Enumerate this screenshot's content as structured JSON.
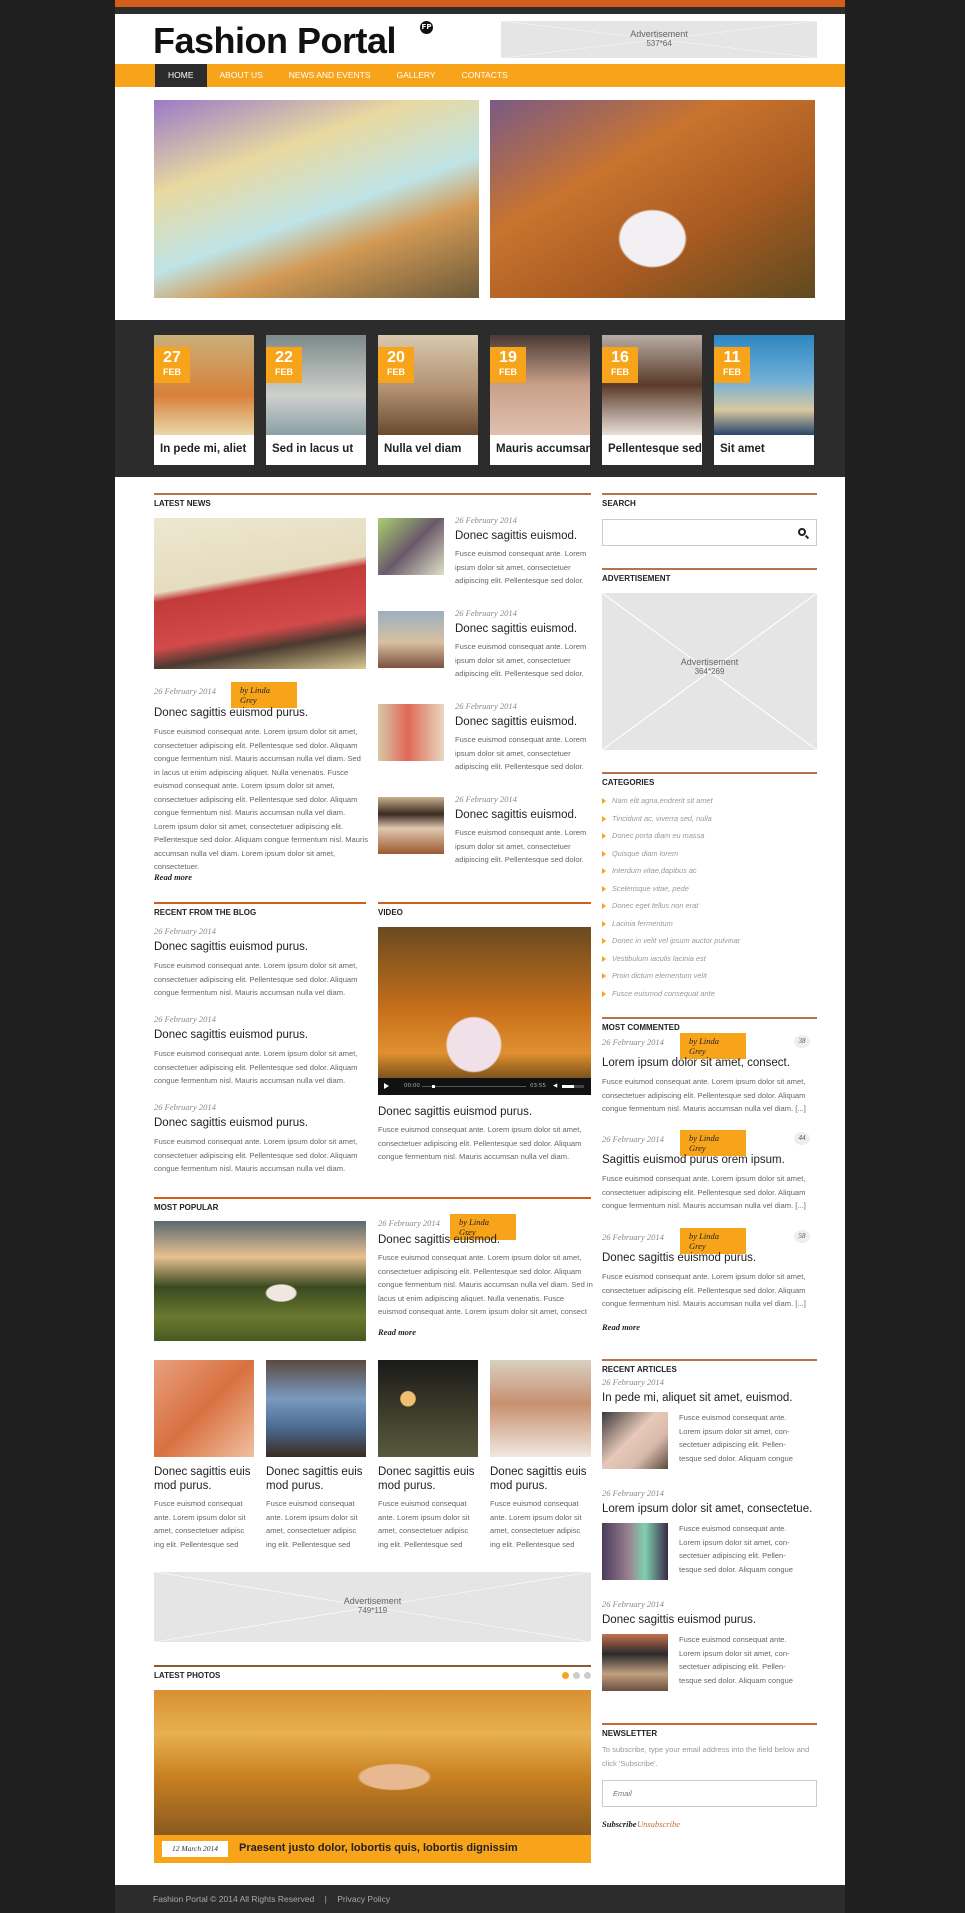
{
  "header": {
    "logo": "Fashion Portal",
    "logo_mark": "FP",
    "ad": {
      "label": "Advertisement",
      "size": "537*64"
    }
  },
  "nav": {
    "items": [
      {
        "label": "HOME",
        "active": true
      },
      {
        "label": "ABOUT US"
      },
      {
        "label": "NEWS AND EVENTS"
      },
      {
        "label": "GALLERY"
      },
      {
        "label": "CONTACTS"
      }
    ]
  },
  "hero": {
    "images": [
      "woman-with-painted-horse",
      "bride-in-autumn-field"
    ]
  },
  "featured_strip": [
    {
      "day": "27",
      "month": "FEB",
      "caption": "In pede mi, aliet"
    },
    {
      "day": "22",
      "month": "FEB",
      "caption": "Sed in lacus ut"
    },
    {
      "day": "20",
      "month": "FEB",
      "caption": "Nulla vel diam"
    },
    {
      "day": "19",
      "month": "FEB",
      "caption": "Mauris accumsan"
    },
    {
      "day": "16",
      "month": "FEB",
      "caption": "Pellentesque sed"
    },
    {
      "day": "11",
      "month": "FEB",
      "caption": "Sit amet"
    }
  ],
  "latest_news": {
    "title": "LATEST NEWS",
    "main": {
      "date": "26 February 2014",
      "author": "by Linda Grey",
      "headline": "Donec sagittis euismod purus.",
      "body": "Fusce euismod consequat ante. Lorem ipsum dolor sit amet, consectetuer adipiscing elit. Pellentesque sed dolor. Aliquam congue fermentum nisl. Mauris accumsan nulla vel diam. Sed in lacus ut enim adipiscing aliquet. Nulla venenatis. Fusce euismod consequat ante. Lorem ipsum dolor sit amet, consectetuer adipiscing elit. Pellentesque sed dolor. Aliquam congue fermentum nisl. Mauris accumsan nulla vel diam. Lorem ipsum dolor sit amet, consectetuer adipiscing elit. Pellentesque sed dolor. Aliquam congue fermentum nisl. Mauris accumsan nulla vel diam. Lorem ipsum dolor sit amet, consectetuer.",
      "read_more": "Read more"
    },
    "items": [
      {
        "date": "26 February 2014",
        "headline": "Donec sagittis euismod.",
        "body": "Fusce euismod consequat ante. Lorem ipsum dolor sit amet, consectetuer adipiscing elit. Pellentesque sed dolor."
      },
      {
        "date": "26 February 2014",
        "headline": "Donec sagittis euismod.",
        "body": "Fusce euismod consequat ante. Lorem ipsum dolor sit amet, consectetuer adipiscing elit. Pellentesque sed dolor."
      },
      {
        "date": "26 February 2014",
        "headline": "Donec sagittis euismod.",
        "body": "Fusce euismod consequat ante. Lorem ipsum dolor sit amet, consectetuer adipiscing elit. Pellentesque sed dolor."
      },
      {
        "date": "26 February 2014",
        "headline": "Donec sagittis euismod.",
        "body": "Fusce euismod consequat ante. Lorem ipsum dolor sit amet, consectetuer adipiscing elit. Pellentesque sed dolor."
      }
    ]
  },
  "recent_blog": {
    "title": "RECENT FROM THE BLOG",
    "items": [
      {
        "date": "26 February 2014",
        "headline": "Donec sagittis euismod purus.",
        "body": "Fusce euismod consequat ante. Lorem ipsum dolor sit amet, consectetuer adipiscing elit. Pellentesque sed dolor. Aliquam congue fermentum nisl. Mauris accumsan nulla vel diam."
      },
      {
        "date": "26 February 2014",
        "headline": "Donec sagittis euismod purus.",
        "body": "Fusce euismod consequat ante. Lorem ipsum dolor sit amet, consectetuer adipiscing elit. Pellentesque sed dolor. Aliquam congue fermentum nisl. Mauris accumsan nulla vel diam."
      },
      {
        "date": "26 February 2014",
        "headline": "Donec sagittis euismod purus.",
        "body": "Fusce euismod consequat ante. Lorem ipsum dolor sit amet, consectetuer adipiscing elit. Pellentesque sed dolor. Aliquam congue fermentum nisl. Mauris accumsan nulla vel diam."
      }
    ]
  },
  "video": {
    "title": "VIDEO",
    "current_time": "00:00",
    "duration": "03:55",
    "progress": 0.08,
    "headline": "Donec sagittis euismod purus.",
    "body": "Fusce euismod consequat ante. Lorem ipsum dolor sit amet, consectetuer adipiscing elit. Pellentesque sed dolor. Aliquam congue fermentum nisl. Mauris accumsan nulla vel diam."
  },
  "most_popular": {
    "title": "MOST POPULAR",
    "main": {
      "date": "26 February 2014",
      "author": "by Linda Grey",
      "headline": "Donec sagittis euismod.",
      "body": "Fusce euismod consequat ante. Lorem ipsum dolor sit amet, consectetuer adipiscing elit. Pellentesque sed dolor. Aliquam congue fermentum nisl. Mauris accumsan nulla vel diam. Sed in lacus ut enim adipiscing aliquet. Nulla venenatis. Fusce euismod consequat ante. Lorem ipsum dolor sit amet, consect",
      "read_more": "Read more"
    },
    "grid": [
      {
        "headline": "Donec sagittis euis mod purus.",
        "body": "Fusce euismod consequat ante. Lorem ipsum dolor sit amet, consectetuer adipisc ing elit. Pellentesque sed"
      },
      {
        "headline": "Donec sagittis euis mod purus.",
        "body": "Fusce euismod consequat ante. Lorem ipsum dolor sit amet, consectetuer adipisc ing elit. Pellentesque sed"
      },
      {
        "headline": "Donec sagittis euis mod purus.",
        "body": "Fusce euismod consequat ante. Lorem ipsum dolor sit amet, consectetuer adipisc ing elit. Pellentesque sed"
      },
      {
        "headline": "Donec sagittis euis mod purus.",
        "body": "Fusce euismod consequat ante. Lorem ipsum dolor sit amet, consectetuer adipisc ing elit. Pellentesque sed"
      }
    ]
  },
  "wide_ad": {
    "label": "Advertisement",
    "size": "749*119"
  },
  "latest_photos": {
    "title": "LATEST PHOTOS",
    "date": "12 March 2014",
    "caption": "Praesent justo dolor, lobortis quis, lobortis dignissim",
    "slides": 3,
    "active_slide": 1
  },
  "sidebar": {
    "search": {
      "title": "SEARCH",
      "placeholder": ""
    },
    "ad": {
      "title": "ADVERTISEMENT",
      "label": "Advertisement",
      "size": "364*269"
    },
    "categories": {
      "title": "CATEGORIES",
      "items": [
        "Nam elit agna,endrerit sit amet",
        "Tincidunt ac, viverra sed, nulla",
        "Donec porta diam eu massa",
        "Quisque diam lorem",
        "Interdum vitae,dapibus ac",
        "Scelerisque vitae, pede",
        "Donec eget tellus non erat",
        "Lacinia fermentum",
        "Donec in velit vel ipsum auctor pulvinar",
        "Vestibulum iaculis lacinia est",
        "Proin dictum elementum velit",
        "Fusce euismod consequat ante"
      ]
    },
    "most_commented": {
      "title": "MOST COMMENTED",
      "items": [
        {
          "date": "26 February 2014",
          "author": "by Linda Grey",
          "comments": "38",
          "headline": "Lorem ipsum dolor sit amet, consect.",
          "body": "Fusce euismod consequat ante. Lorem ipsum dolor sit amet, consectetuer adipiscing elit. Pellentesque sed dolor. Aliquam congue fermentum nisl. Mauris accumsan nulla vel diam. [...]"
        },
        {
          "date": "26 February 2014",
          "author": "by Linda Grey",
          "comments": "44",
          "headline": "Sagittis euismod purus orem ipsum.",
          "body": "Fusce euismod consequat ante. Lorem ipsum dolor sit amet, consectetuer adipiscing elit. Pellentesque sed dolor. Aliquam congue fermentum nisl. Mauris accumsan nulla vel diam. [...]"
        },
        {
          "date": "26 February 2014",
          "author": "by Linda Grey",
          "comments": "58",
          "headline": "Donec sagittis euismod purus.",
          "body": "Fusce euismod consequat ante. Lorem ipsum dolor sit amet, consectetuer adipiscing elit. Pellentesque sed dolor. Aliquam congue fermentum nisl. Mauris accumsan nulla vel diam. [...]"
        }
      ],
      "read_more": "Read more"
    },
    "recent_articles": {
      "title": "RECENT ARTICLES",
      "items": [
        {
          "date": "26 February 2014",
          "headline": "In pede mi, aliquet sit amet, euismod.",
          "body": "Fusce euismod consequat ante. Lorem ipsum dolor sit amet, con-sectetuer adipiscing elit. Pellen-tesque sed dolor. Aliquam congue"
        },
        {
          "date": "26 February 2014",
          "headline": "Lorem ipsum dolor sit amet, consectetue.",
          "body": "Fusce euismod consequat ante. Lorem ipsum dolor sit amet, con-sectetuer adipiscing elit. Pellen-tesque sed dolor. Aliquam congue"
        },
        {
          "date": "26 February 2014",
          "headline": "Donec sagittis euismod purus.",
          "body": "Fusce euismod consequat ante. Lorem ipsum dolor sit amet, con-sectetuer adipiscing elit. Pellen-tesque sed dolor. Aliquam congue"
        }
      ]
    },
    "newsletter": {
      "title": "NEWSLETTER",
      "text": "To subscribe, type your email address into the field below and click 'Subscribe'.",
      "placeholder": "Email",
      "subscribe": "Subscribe",
      "unsubscribe": "Unsubscribe"
    }
  },
  "footer": {
    "copyright": "Fashion Portal © 2014 All Rights Reserved",
    "separator": "|",
    "privacy": "Privacy Policy"
  },
  "colors": {
    "accent": "#f7a41b",
    "topbar": "#d35d1a",
    "dark": "#2c2c2c",
    "rule": "#b5734b"
  }
}
